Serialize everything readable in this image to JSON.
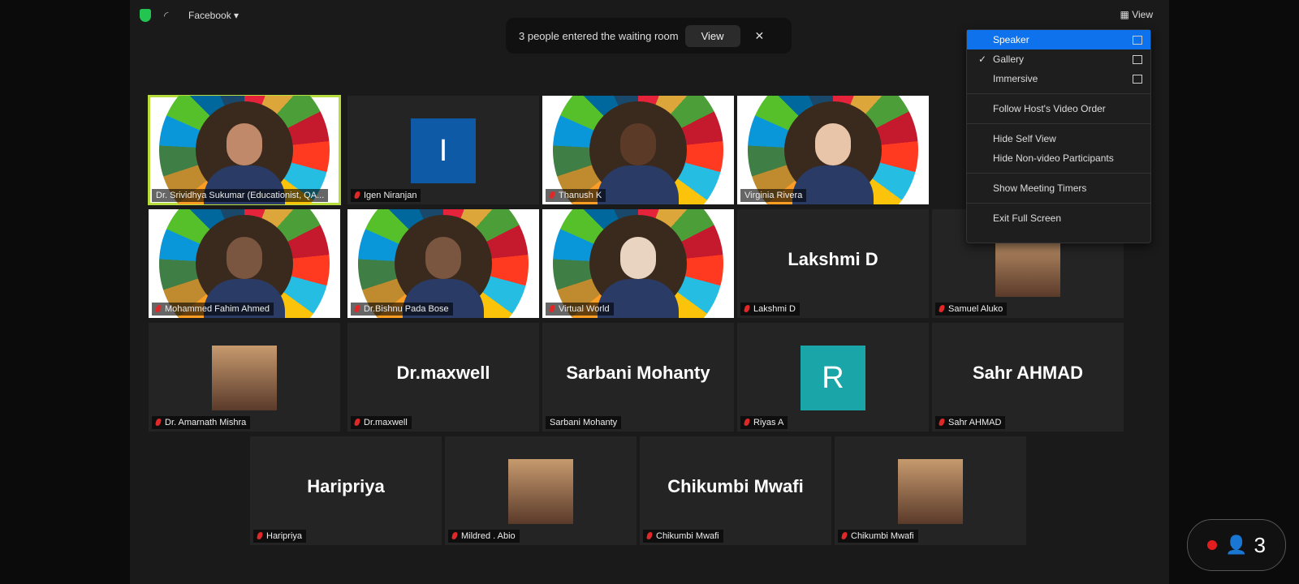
{
  "topbar": {
    "stream_label": "Facebook",
    "view_label": "View"
  },
  "notification": {
    "text": "3 people entered the waiting room",
    "button": "View"
  },
  "view_menu": {
    "items": [
      {
        "label": "Speaker",
        "selected": true
      },
      {
        "label": "Gallery",
        "checked": true
      },
      {
        "label": "Immersive"
      },
      {
        "label": "Follow Host's Video Order"
      },
      {
        "label": "Hide Self View"
      },
      {
        "label": "Hide Non-video Participants"
      },
      {
        "label": "Show Meeting Timers"
      },
      {
        "label": "Exit Full Screen"
      }
    ]
  },
  "participants": [
    {
      "name": "Dr. Srividhya Sukumar (Educationist, QA...",
      "type": "video",
      "active": true,
      "muted": false
    },
    {
      "name": "Igen Niranjan",
      "type": "letter",
      "letter": "I",
      "color": "#0e5aa7",
      "muted": true
    },
    {
      "name": "Thanush K",
      "type": "video",
      "muted": true
    },
    {
      "name": "Virginia Rivera",
      "type": "video",
      "muted": false
    },
    {
      "name": "Mohammed Fahim Ahmed",
      "type": "video",
      "muted": true
    },
    {
      "name": "Dr.Bishnu Pada Bose",
      "type": "video",
      "muted": true
    },
    {
      "name": "Virtual World",
      "type": "video",
      "muted": true
    },
    {
      "name": "Lakshmi D",
      "type": "name",
      "big": "Lakshmi D",
      "muted": true
    },
    {
      "name": "Samuel Aluko",
      "type": "photo",
      "muted": true
    },
    {
      "name": "Dr. Amarnath Mishra",
      "type": "photo",
      "muted": true
    },
    {
      "name": "Dr.maxwell",
      "type": "name",
      "big": "Dr.maxwell",
      "muted": true
    },
    {
      "name": "Sarbani Mohanty",
      "type": "name",
      "big": "Sarbani Mohanty",
      "muted": false
    },
    {
      "name": "Riyas A",
      "type": "letter",
      "letter": "R",
      "color": "#1aa5a8",
      "muted": true
    },
    {
      "name": "Sahr AHMAD",
      "type": "name",
      "big": "Sahr AHMAD",
      "muted": true
    },
    {
      "name": "Haripriya",
      "type": "name",
      "big": "Haripriya",
      "muted": true
    },
    {
      "name": "Mildred . Abio",
      "type": "photo",
      "muted": true
    },
    {
      "name": "Chikumbi Mwafi",
      "type": "name",
      "big": "Chikumbi Mwafi",
      "muted": true
    },
    {
      "name": "Chikumbi Mwafi",
      "type": "photo",
      "muted": true
    }
  ],
  "recording": {
    "count": "3"
  }
}
